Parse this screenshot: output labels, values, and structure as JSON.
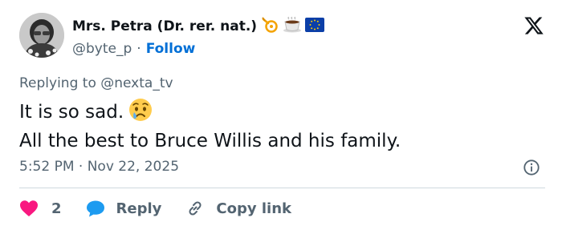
{
  "author": {
    "display_name": "Mrs. Petra (Dr. rer. nat.)",
    "handle": "@byte_p",
    "separator": "·",
    "follow_label": "Follow",
    "badge_icons": [
      "posthorn-icon",
      "coffee-cup-icon",
      "eu-flag-icon"
    ]
  },
  "tweet": {
    "replying_prefix": "Replying to",
    "replying_handle": "@nexta_tv",
    "line1": "It is so sad.",
    "line1_emoji": "sad-tear-face-icon",
    "line2": "All the best to Bruce Willis and his family.",
    "time": "5:52 PM",
    "separator": "·",
    "date": "Nov 22, 2025"
  },
  "actions": {
    "like_count": "2",
    "reply_label": "Reply",
    "copy_label": "Copy link"
  },
  "colors": {
    "text": "#0f1419",
    "muted": "#536471",
    "link": "#006fd6",
    "like": "#f91880",
    "reply": "#1d9bf0",
    "divider": "#cfd9de"
  }
}
